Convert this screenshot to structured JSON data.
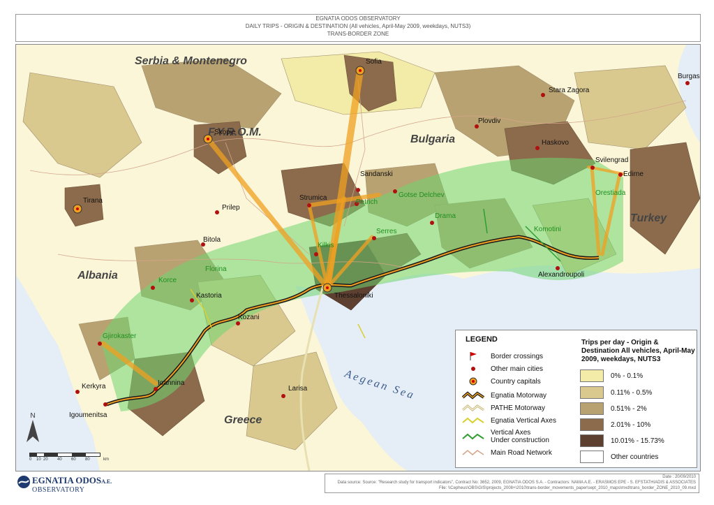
{
  "header": {
    "line1": "EGNATIA ODOS OBSERVATORY",
    "line2": "DAILY TRIPS - ORIGIN & DESTINATION (All vehicles, April-May 2009, weekdays, NUTS3)",
    "line3": "TRANS-BORDER ZONE"
  },
  "map": {
    "countries": [
      "Serbia & Montenegro",
      "F.Y.R.O.M.",
      "Bulgaria",
      "Albania",
      "Turkey",
      "Greece"
    ],
    "sea": "Aegean Sea",
    "capitals": [
      "Sofia",
      "Skopje",
      "Tirana",
      "Thessaloniki"
    ],
    "cities": [
      "Burgas",
      "Stara Zagora",
      "Plovdiv",
      "Haskovo",
      "Svilengrad",
      "Edirne",
      "Sandanski",
      "Strumica",
      "Petrich",
      "Gotse Delchev",
      "Drama",
      "Serres",
      "Kilkis",
      "Prilep",
      "Bitola",
      "Florina",
      "Korce",
      "Kastoria",
      "Kozani",
      "Gjirokaster",
      "Ioannina",
      "Kerkyra",
      "Igoumenitsa",
      "Larisa",
      "Komotini",
      "Alexandroupoli",
      "Orestiada"
    ],
    "colors": {
      "class1": "#f3eba8",
      "class2": "#d9c98f",
      "class3": "#b9a271",
      "class4": "#8c6b4c",
      "class5": "#5e4031",
      "other": "#ffffff",
      "sea": "#e5eef6",
      "zone": "#6fd66f",
      "flow": "#f0a020"
    }
  },
  "legend": {
    "title": "LEGEND",
    "items": [
      "Border crossings",
      "Other main cities",
      "Country capitals",
      "Egnatia Motorway",
      "PATHE Motorway",
      "Egnatia Vertical Axes",
      "Vertical Axes\nUnder construction",
      "Main Road Network"
    ],
    "classes_title": "Trips per day - Origin & Destination All vehicles, April-May 2009, weekdays, NUTS3",
    "classes": [
      "0% - 0.1%",
      "0.11% - 0.5%",
      "0.51% - 2%",
      "2.01% - 10%",
      "10.01% - 15.73%",
      "Other countries"
    ]
  },
  "scale": {
    "ticks": [
      "0",
      "10",
      "20",
      "40",
      "60",
      "80"
    ],
    "unit": "km"
  },
  "north": "N",
  "logo": {
    "name": "EGNATIA ODOS",
    "suffix": "A.E.",
    "sub": "OBSERVATORY"
  },
  "footer": {
    "date": "Date : 20/09/2010",
    "source": "Data source: Source: \"Research study for transport indicators\", Contract No: 3652, 2009, EGNATIA ODOS S.A. - Contractors: NAMA A.E. - ERASMOS EPE - S. EFSTATHIADIS & ASSOCIATES",
    "file": "File: \\\\Cepheus\\OBS\\GIS\\projects_2008+\\2010\\trans-border_movements_paper\\sept_2010_maps\\mxd\\trans_border_ZONE_2010_09.mxd"
  }
}
